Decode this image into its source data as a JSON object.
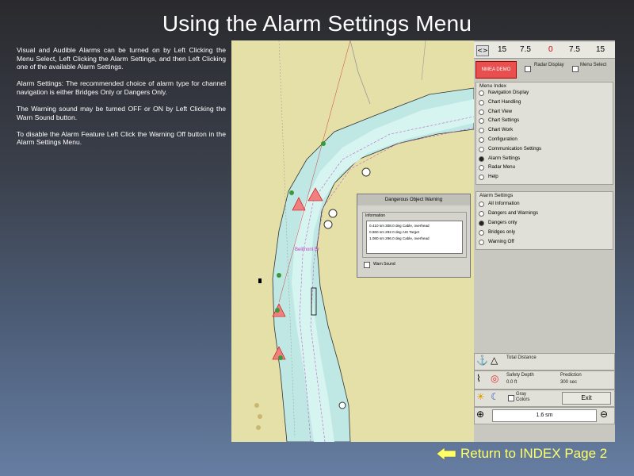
{
  "title": "Using the Alarm Settings Menu",
  "instructions": [
    "Visual and Audible Alarms can be turned on by Left Clicking the Menu Select, Left Clicking the Alarm Settings, and then Left Clicking one of the available Alarm Settings.",
    "Alarm Settings:  The recommended choice of alarm type for channel navigation is either Bridges Only or Dangers Only.",
    "The Warning sound may be turned OFF or ON by Left Clicking the Warn Sound button.",
    "To disable the Alarm Feature Left Click the Warning Off button in the Alarm Settings Menu."
  ],
  "map": {
    "label": "Bellmont Br"
  },
  "panel": {
    "scale_toggle": "<>",
    "scale_ticks": [
      "15",
      "7.5",
      "0",
      "7.5",
      "15"
    ],
    "nmea_button": "NMEA DEMO",
    "radar_display": "Radar Display",
    "menu_select": "Menu Select",
    "menu_index_title": "Menu Index",
    "menu_items": [
      "Navigation Display",
      "Chart Handling",
      "Chart View",
      "Chart Settings",
      "Chart Work",
      "Configuration",
      "Communication Settings",
      "Alarm Settings",
      "Radar Menu",
      "Help"
    ],
    "alarm_title": "Alarm Settings",
    "alarm_items": [
      "All Information",
      "Dangers and Warnings",
      "Dangers only",
      "Bridges only",
      "Warning Off"
    ],
    "total_distance_label": "Total Distance",
    "safety_depth_label": "Safety Depth",
    "safety_depth_value": "0.0 ft",
    "prediction_label": "Prediction",
    "prediction_value": "300 sec",
    "gray_colors": "Gray Colors",
    "exit_button": "Exit",
    "zoom_value": "1.6 sm"
  },
  "dialog": {
    "title": "Dangerous Object Warning",
    "info_label": "Information",
    "rows": [
      "0.410 sm   308.0 deg   Cable, overhead",
      "0.860 sm   292.0 deg   AIS Target",
      "1.080 sm   296.0 deg   Cable, overhead"
    ],
    "warn_sound": "Warn Sound"
  },
  "return_link": "Return to INDEX Page 2",
  "colors": {
    "water": "#bfe8e4",
    "channel": "#d6f4f0",
    "land": "#e4e0a8",
    "nmea": "#e85050",
    "return_text": "#ffff66"
  }
}
